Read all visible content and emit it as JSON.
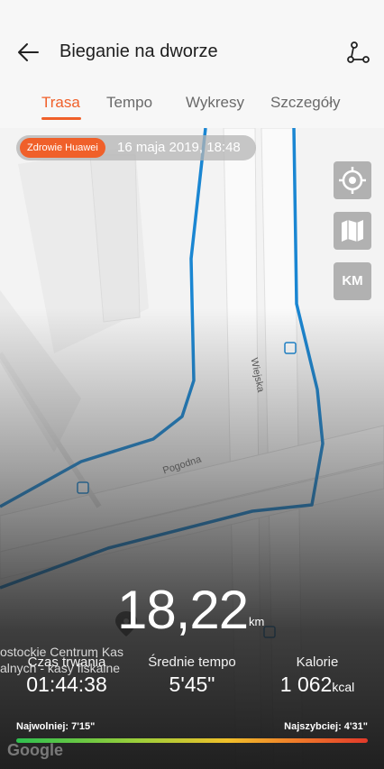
{
  "header": {
    "title": "Bieganie na dworze"
  },
  "tabs": [
    {
      "label": "Trasa",
      "active": true
    },
    {
      "label": "Tempo",
      "active": false
    },
    {
      "label": "Wykresy",
      "active": false
    },
    {
      "label": "Szczegóły",
      "active": false
    }
  ],
  "map": {
    "source_badge": "Zdrowie Huawei",
    "date": "16 maja 2019, 18:48",
    "units_button": "KM",
    "streets": {
      "wiejska": "Wiejska",
      "pogodna": "Pogodna"
    },
    "poi_lines": [
      "ostockie Centrum Kas",
      "alnych - kasy fiskalne"
    ],
    "attribution": "Google",
    "route_color": "#1a86d2"
  },
  "summary": {
    "distance": "18,22",
    "distance_unit": "km",
    "stats": {
      "duration": {
        "label": "Czas trwania",
        "value": "01:44:38"
      },
      "avg_pace": {
        "label": "Średnie tempo",
        "value": "5'45\""
      },
      "calories": {
        "label": "Kalorie",
        "value": "1 062",
        "unit": "kcal"
      }
    },
    "pace_scale": {
      "slowest": "Najwolniej: 7'15\"",
      "fastest": "Najszybciej: 4'31\""
    }
  },
  "colors": {
    "accent": "#f0602a",
    "route": "#1a86d2"
  }
}
